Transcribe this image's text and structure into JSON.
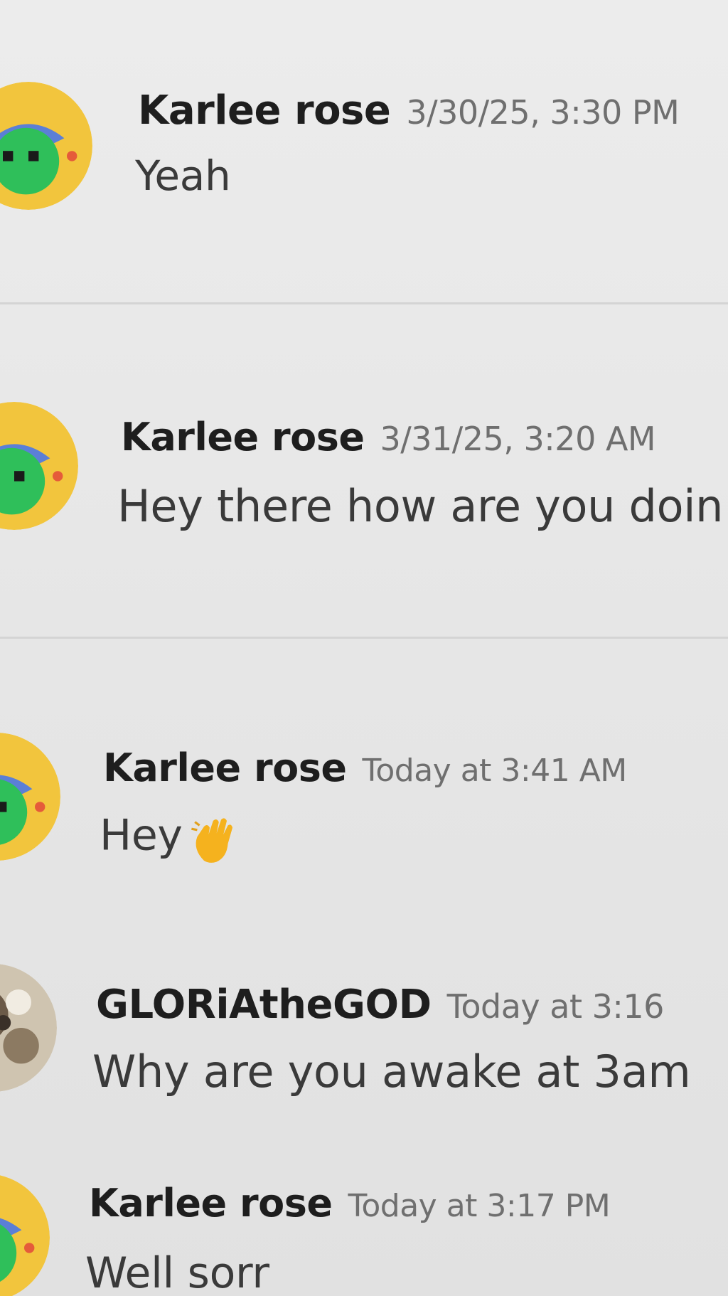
{
  "messages": [
    {
      "author": "Karlee rose",
      "timestamp": "3/30/25, 3:30 PM",
      "text": "Yeah",
      "avatar_icon": "green-character-avatar-icon"
    },
    {
      "author": "Karlee rose",
      "timestamp": "3/31/25, 3:20 AM",
      "text": "Hey there how are you doin",
      "avatar_icon": "green-character-avatar-icon"
    },
    {
      "author": "Karlee rose",
      "timestamp": "Today at 3:41 AM",
      "text": "Hey",
      "emoji": "waving-hand-icon",
      "avatar_icon": "green-character-avatar-icon"
    },
    {
      "author": "GLORiAtheGOD",
      "timestamp": "Today at 3:16",
      "text": "Why are you awake at 3am",
      "avatar_icon": "photo-avatar-icon"
    },
    {
      "author": "Karlee rose",
      "timestamp": "Today at 3:17 PM",
      "text": "Well sorr",
      "avatar_icon": "green-character-avatar-icon"
    }
  ],
  "colors": {
    "avatar_yellow": "#f2c53d",
    "avatar_green": "#2fbf5a",
    "avatar_blue": "#5b7fd6",
    "background": "#e9e9e9",
    "author": "#1e1e1e",
    "timestamp": "#6f6f6f"
  }
}
